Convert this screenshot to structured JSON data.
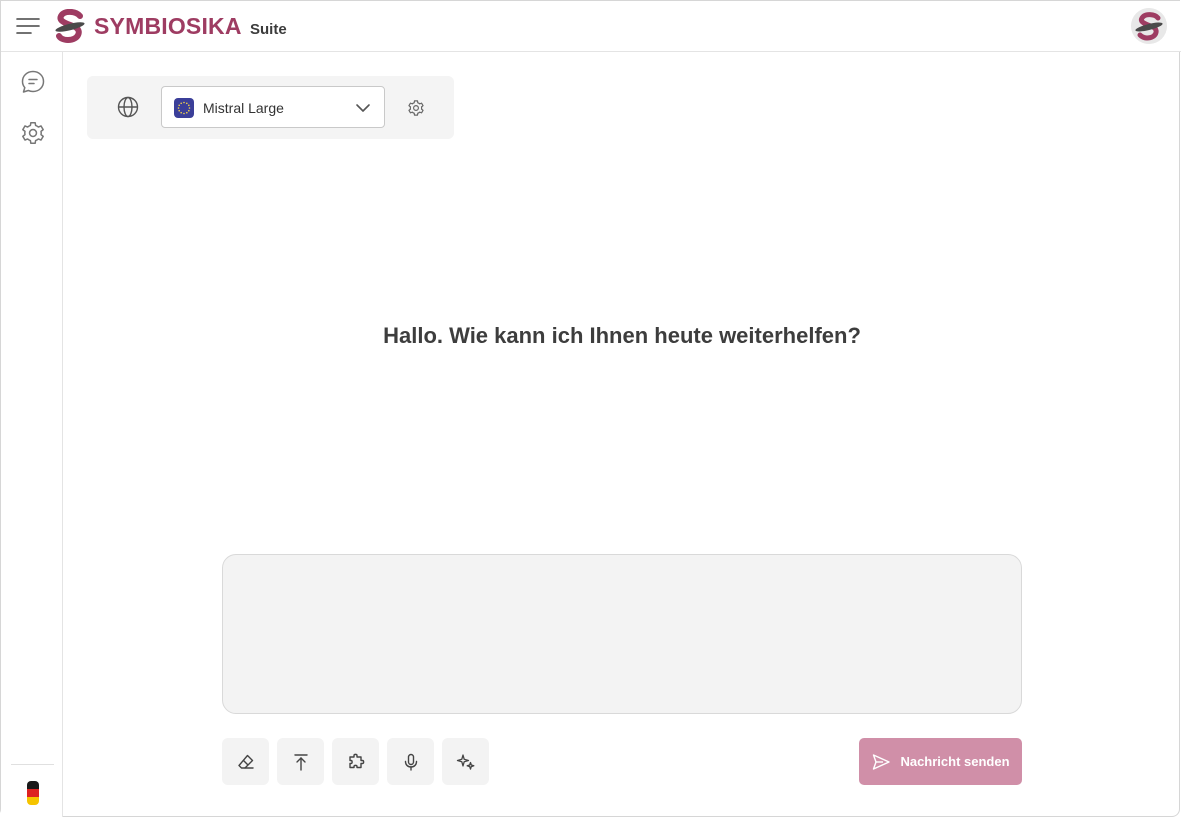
{
  "header": {
    "brand": "SYMBIOSIKA",
    "suite": "Suite",
    "menu_icon": "hamburger-menu-icon",
    "logo_icon": "symbiosika-logo-icon",
    "avatar_icon": "user-avatar-icon"
  },
  "sidebar": {
    "items": [
      {
        "icon": "chat-bubble-icon"
      },
      {
        "icon": "gear-icon"
      }
    ],
    "language_icon": "german-flag-icon"
  },
  "model_bar": {
    "web_icon": "globe-icon",
    "selected_model": "Mistral Large",
    "model_flag_icon": "eu-flag-icon",
    "settings_icon": "gear-icon"
  },
  "greeting": "Hallo. Wie kann ich Ihnen heute weiterhelfen?",
  "composer": {
    "message_value": "",
    "tools": [
      {
        "name": "eraser-icon"
      },
      {
        "name": "upload-icon"
      },
      {
        "name": "puzzle-icon"
      },
      {
        "name": "microphone-icon"
      },
      {
        "name": "sparkles-icon"
      }
    ],
    "send_label": "Nachricht senden",
    "send_icon": "send-icon"
  },
  "colors": {
    "brand": "#9e3c62",
    "send_button": "#d08fa8",
    "surface": "#f3f3f3",
    "eu_blue": "#3b3f99"
  }
}
